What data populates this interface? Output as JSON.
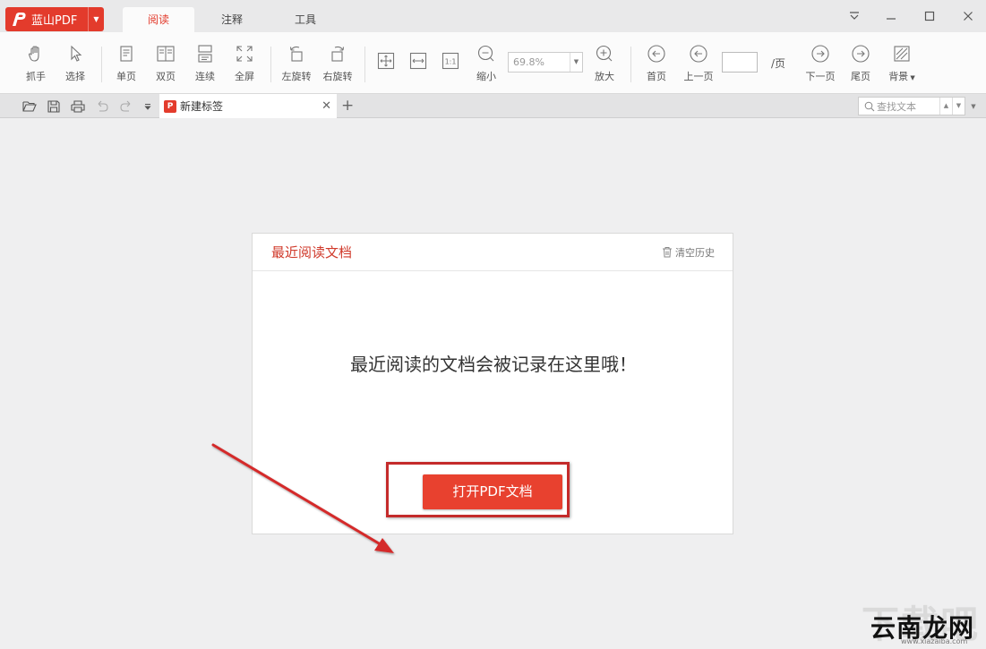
{
  "app": {
    "name": "蓝山PDF"
  },
  "tabs": [
    {
      "label": "阅读",
      "active": true
    },
    {
      "label": "注释",
      "active": false
    },
    {
      "label": "工具",
      "active": false
    }
  ],
  "toolbar": {
    "hand": "抓手",
    "select": "选择",
    "single_page": "单页",
    "double_page": "双页",
    "continuous": "连续",
    "fullscreen": "全屏",
    "rotate_left": "左旋转",
    "rotate_right": "右旋转",
    "zoom_out": "缩小",
    "zoom_value": "69.8%",
    "zoom_in": "放大",
    "first_page": "首页",
    "prev_page": "上一页",
    "page_value": "",
    "page_suffix": "/页",
    "next_page": "下一页",
    "last_page": "尾页",
    "background": "背景"
  },
  "tabstrip": {
    "doc_tab_label": "新建标签",
    "search_placeholder": "查找文本"
  },
  "recent": {
    "title": "最近阅读文档",
    "clear_history": "清空历史",
    "empty_message": "最近阅读的文档会被记录在这里哦！",
    "open_button": "打开PDF文档"
  },
  "watermark": {
    "back_text": "下载吧",
    "front_text": "云南龙网",
    "url": "www.xiazaiba.com"
  },
  "colors": {
    "accent": "#e33b2c",
    "highlight_border": "#c42b2b",
    "arrow": "#d42a2a"
  }
}
